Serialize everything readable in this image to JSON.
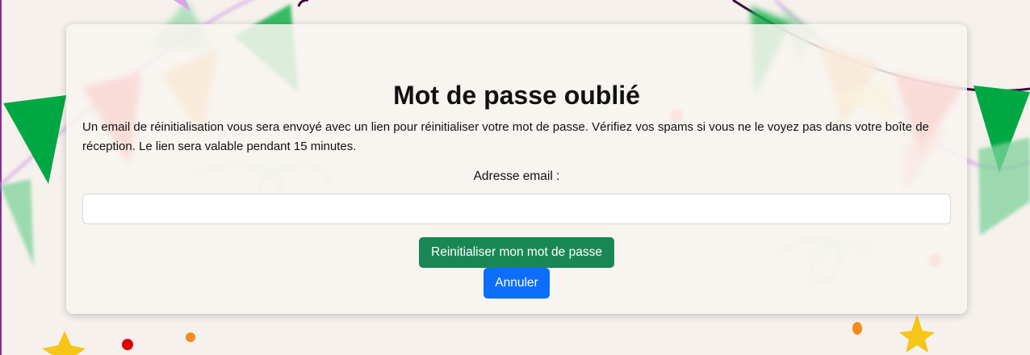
{
  "page": {
    "title": "Mot de passe oublié",
    "description": "Un email de réinitialisation vous sera envoyé avec un lien pour réinitialiser votre mot de passe. Vérifiez vos spams si vous ne le voyez pas dans votre boîte de réception. Le lien sera valable pendant 15 minutes."
  },
  "form": {
    "email_label": "Adresse email :",
    "email_value": "",
    "email_placeholder": "",
    "submit_label": "Reinitialiser mon mot de passe",
    "cancel_label": "Annuler"
  },
  "colors": {
    "background": "#f6f1ed",
    "submit_button": "#198754",
    "cancel_button": "#0d6efd",
    "flag_green": "#00a843",
    "flag_red": "#ff2d2d",
    "flag_orange": "#f9a23f",
    "flag_yellow": "#ffe36b",
    "confetti_gold": "#f5c518"
  },
  "decorations": {
    "background_theme": "party-bunting-and-confetti"
  }
}
